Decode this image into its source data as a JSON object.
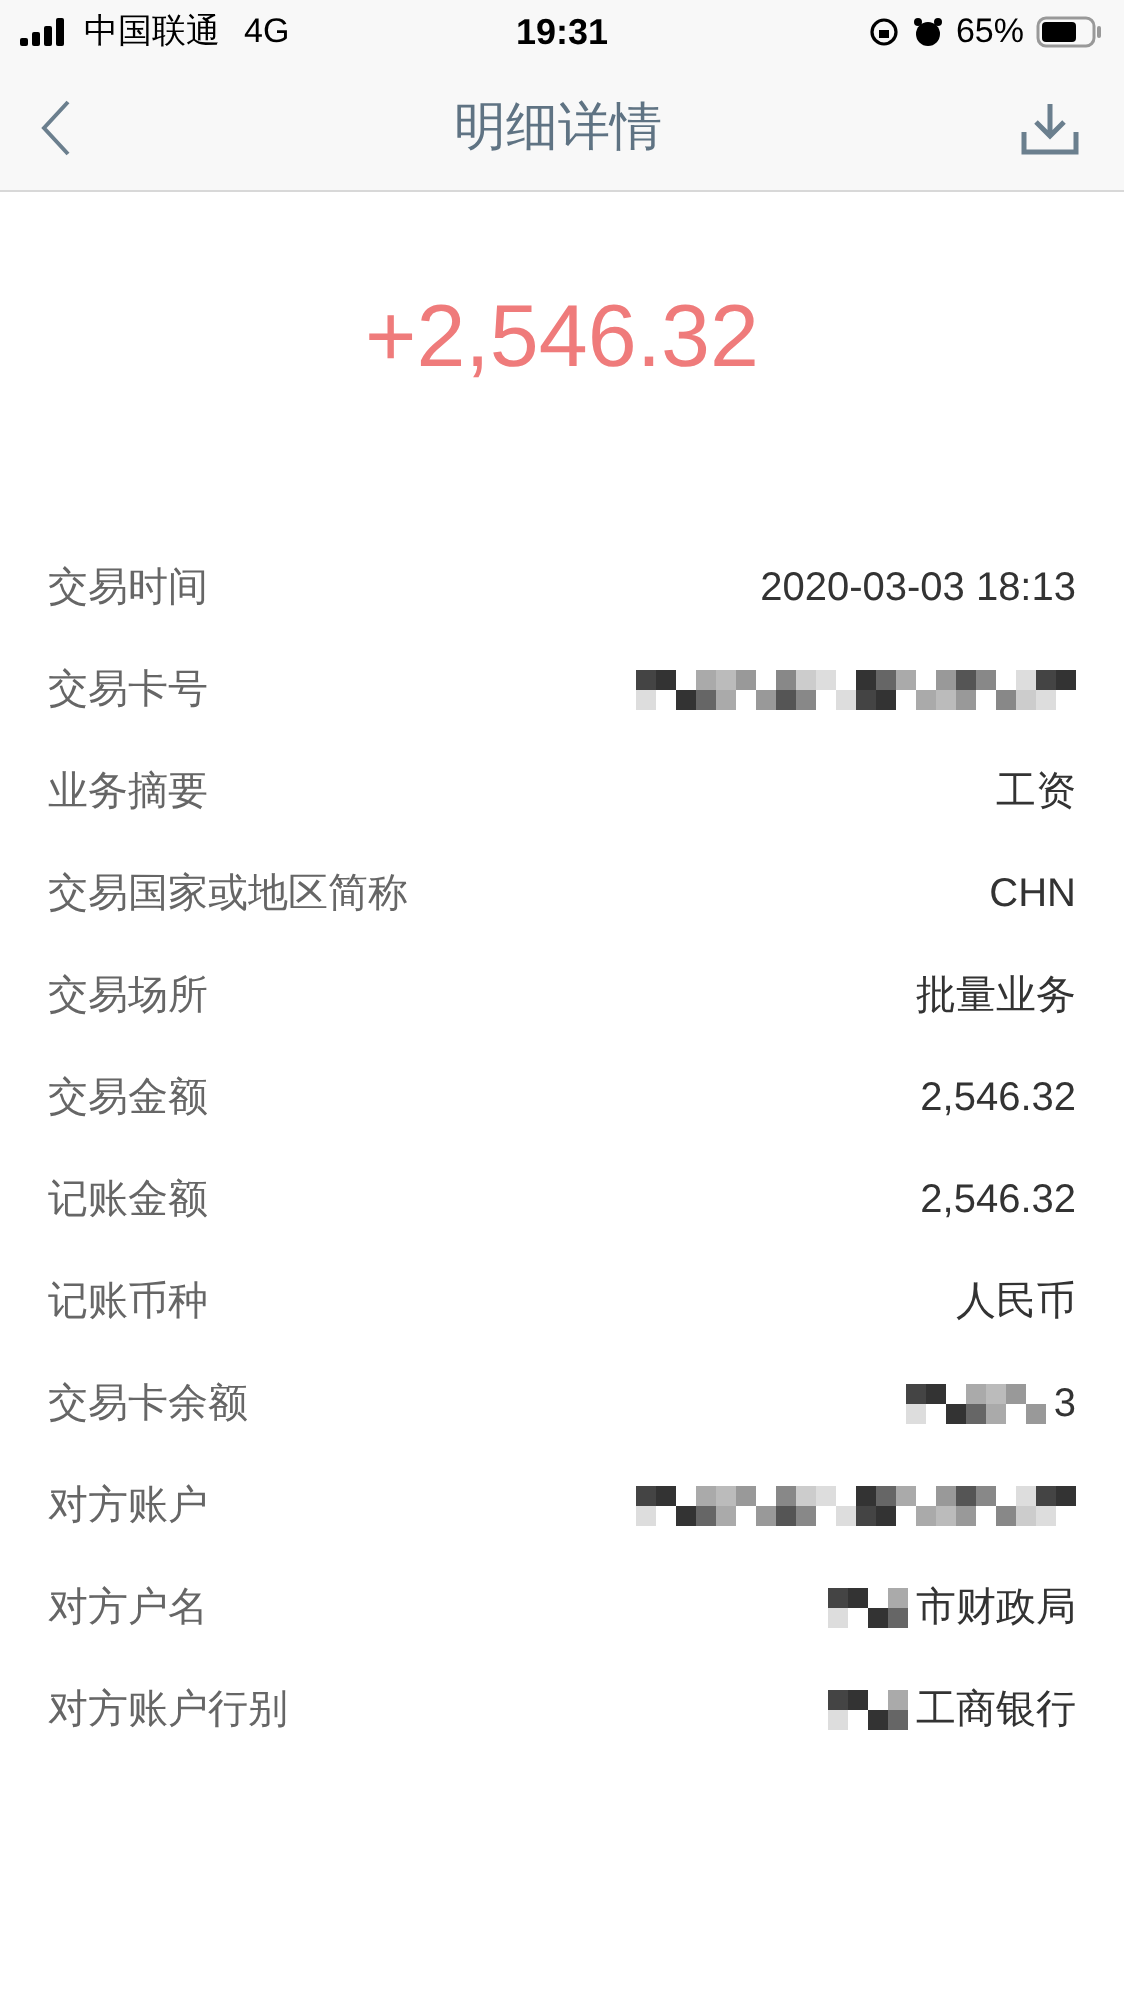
{
  "status_bar": {
    "carrier": "中国联通",
    "network": "4G",
    "time": "19:31",
    "battery": "65%"
  },
  "nav": {
    "title": "明细详情"
  },
  "amount": "+2,546.32",
  "rows": [
    {
      "label": "交易时间",
      "value": "2020-03-03 18:13",
      "kind": "plain"
    },
    {
      "label": "交易卡号",
      "kind": "redacted"
    },
    {
      "label": "业务摘要",
      "value": "工资",
      "kind": "plain"
    },
    {
      "label": "交易国家或地区简称",
      "value": "CHN",
      "kind": "plain"
    },
    {
      "label": "交易场所",
      "value": "批量业务",
      "kind": "plain"
    },
    {
      "label": "交易金额",
      "value": "2,546.32",
      "kind": "plain"
    },
    {
      "label": "记账金额",
      "value": "2,546.32",
      "kind": "plain"
    },
    {
      "label": "记账币种",
      "value": "人民币",
      "kind": "plain"
    },
    {
      "label": "交易卡余额",
      "value": "3",
      "kind": "obscured"
    },
    {
      "label": "对方账户",
      "kind": "redacted"
    },
    {
      "label": "对方户名",
      "value": "市财政局",
      "kind": "partial"
    },
    {
      "label": "对方账户行别",
      "value": "工商银行",
      "kind": "partial"
    }
  ]
}
